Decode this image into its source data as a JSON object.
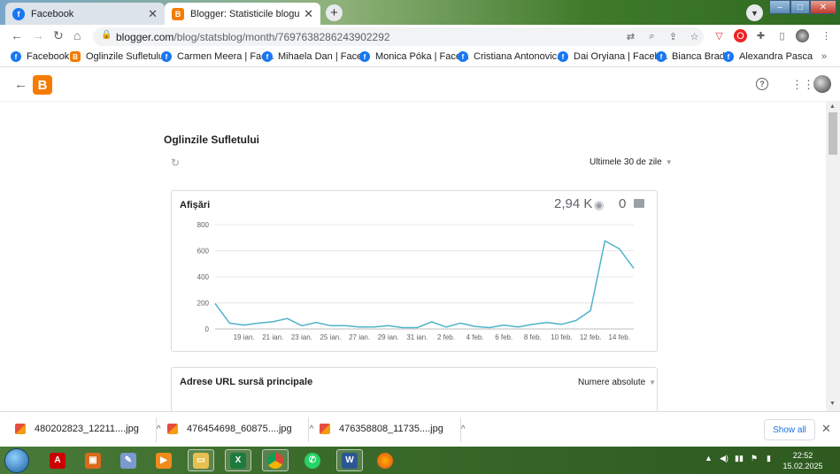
{
  "browser": {
    "tabs": [
      {
        "title": "Facebook",
        "icon": "facebook-icon"
      },
      {
        "title": "Blogger: Statisticile blogului",
        "icon": "blogger-icon"
      }
    ],
    "url_host": "blogger.com",
    "url_path": "/blog/statsblog/month/7697638286243902292"
  },
  "bookmarks": [
    {
      "label": "Facebook",
      "icon": "facebook-icon"
    },
    {
      "label": "Oglinzile Sufletului",
      "icon": "blogger-icon"
    },
    {
      "label": "Carmen Meera | Fac...",
      "icon": "facebook-icon"
    },
    {
      "label": "Mihaela Dan | Face...",
      "icon": "facebook-icon"
    },
    {
      "label": "Monica Póka | Face...",
      "icon": "facebook-icon"
    },
    {
      "label": "Cristiana Antonovic...",
      "icon": "facebook-icon"
    },
    {
      "label": "Dai Oryiana | Faceb...",
      "icon": "facebook-icon"
    },
    {
      "label": "Bianca Brad",
      "icon": "facebook-icon"
    },
    {
      "label": "Alexandra Pasca",
      "icon": "facebook-icon"
    }
  ],
  "page": {
    "blog_name": "Oglinzile Sufletului",
    "range_label": "Ultimele 30 de zile",
    "views_card": {
      "title": "Afișări",
      "total_views": "2,94 K",
      "comments": "0"
    },
    "referrers_card": {
      "title": "Adrese URL sursă principale",
      "mode_label": "Numere absolute"
    }
  },
  "chart_data": {
    "type": "line",
    "x": [
      "17 ian.",
      "18 ian.",
      "19 ian.",
      "20 ian.",
      "21 ian.",
      "22 ian.",
      "23 ian.",
      "24 ian.",
      "25 ian.",
      "26 ian.",
      "27 ian.",
      "28 ian.",
      "29 ian.",
      "30 ian.",
      "31 ian.",
      "1 feb.",
      "2 feb.",
      "3 feb.",
      "4 feb.",
      "5 feb.",
      "6 feb.",
      "7 feb.",
      "8 feb.",
      "9 feb.",
      "10 feb.",
      "11 feb.",
      "12 feb.",
      "13 feb.",
      "14 feb.",
      "15 feb."
    ],
    "values": [
      195,
      45,
      30,
      45,
      55,
      80,
      25,
      50,
      25,
      25,
      15,
      15,
      25,
      10,
      10,
      55,
      15,
      45,
      20,
      10,
      30,
      15,
      35,
      50,
      35,
      65,
      140,
      675,
      615,
      465
    ],
    "x_tick_labels": [
      "19 ian.",
      "21 ian.",
      "23 ian.",
      "25 ian.",
      "27 ian.",
      "29 ian.",
      "31 ian.",
      "2 feb.",
      "4 feb.",
      "6 feb.",
      "8 feb.",
      "10 feb.",
      "12 feb.",
      "14 feb."
    ],
    "y_ticks": [
      0,
      200,
      400,
      600,
      800
    ],
    "ylim": [
      0,
      800
    ],
    "grid": true,
    "color": "#4fb3c8"
  },
  "downloads": [
    {
      "name": "480202823_12211....jpg"
    },
    {
      "name": "476454698_60875....jpg"
    },
    {
      "name": "476358808_11735....jpg"
    }
  ],
  "download_show_all": "Show all",
  "clock": {
    "time": "22:52",
    "date": "15.02.2025"
  }
}
